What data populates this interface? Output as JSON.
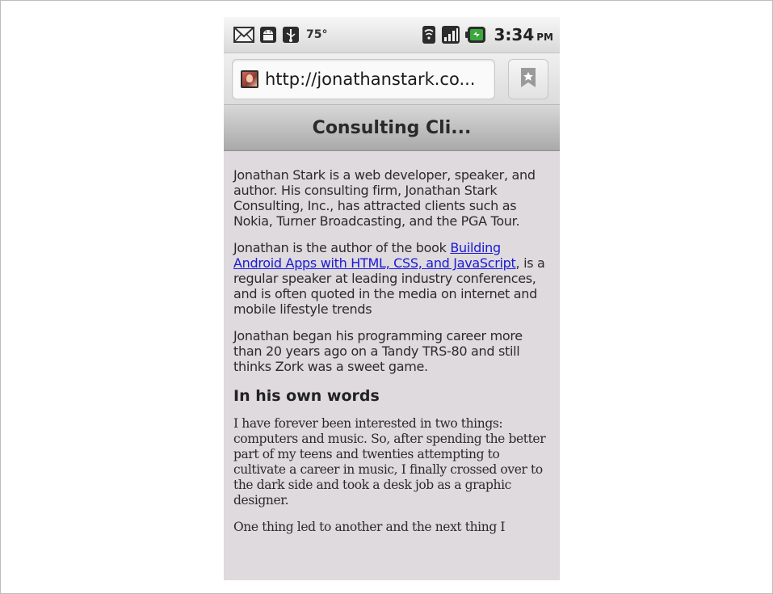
{
  "status_bar": {
    "temperature": "75°",
    "time": "3:34",
    "ampm": "PM",
    "icons": [
      "mail-icon",
      "android-icon",
      "usb-icon",
      "wifi-icon",
      "signal-icon",
      "battery-icon"
    ]
  },
  "browser": {
    "url": "http://jonathanstark.co...",
    "bookmark_icon": "bookmark-icon"
  },
  "page": {
    "title": "Consulting Cli...",
    "para1": "Jonathan Stark is a web developer, speaker, and author. His consulting firm, Jonathan Stark Consulting, Inc., has attracted clients such as Nokia, Turner Broadcasting, and the PGA Tour.",
    "para2_before": "Jonathan is the author of the book ",
    "para2_link": "Building Android Apps with HTML, CSS, and JavaScript",
    "para2_after": ", is a regular speaker at leading industry conferences, and is often quoted in the media on internet and mobile lifestyle trends",
    "para3": "Jonathan began his programming career more than 20 years ago on a Tandy TRS-80 and still thinks Zork was a sweet game.",
    "heading": "In his own words",
    "para4": "I have forever been interested in two things: computers and music. So, after spending the better part of my teens and twenties attempting to cultivate a career in music, I finally crossed over to the dark side and took a desk job as a graphic designer.",
    "para5": "One thing led to another and the next thing I"
  },
  "colors": {
    "content_background": "#dedadd",
    "link": "#1a1ad6",
    "battery_green": "#3aa83a"
  }
}
